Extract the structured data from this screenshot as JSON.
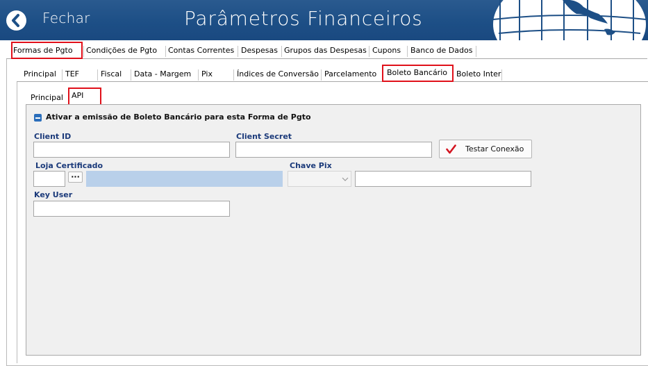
{
  "header": {
    "back_label": "Fechar",
    "title": "Parâmetros Financeiros",
    "icons": {
      "back": "chevron-left-icon",
      "logo": "globe-icon"
    }
  },
  "main_tabs": [
    "Formas de Pgto",
    "Condições de Pgto",
    "Contas Correntes",
    "Despesas",
    "Grupos das Despesas",
    "Cupons",
    "Banco de Dados"
  ],
  "main_tabs_selected": "Formas de Pgto",
  "sub_tabs": [
    "Principal",
    "TEF",
    "Fiscal",
    "Data - Margem",
    "Pix",
    "Índices de Conversão",
    "Parcelamento",
    "Boleto Bancário",
    "Boleto Inter"
  ],
  "sub_tabs_selected": "Boleto Bancário",
  "inner_tabs": [
    "Principal",
    "API"
  ],
  "inner_tabs_selected": "API",
  "form": {
    "activate_checkbox_label": "Ativar a emissão de Boleto Bancário para esta Forma de Pgto",
    "activate_checked": true,
    "client_id_label": "Client ID",
    "client_id_value": "",
    "client_secret_label": "Client Secret",
    "client_secret_value": "",
    "test_button_label": "Testar Conexão",
    "test_button_icon": "checkmark-icon",
    "loja_cert_label": "Loja Certificado",
    "loja_cert_value": "",
    "browse_button_label": "···",
    "chave_pix_label": "Chave Pix",
    "chave_pix_select_value": "",
    "chave_pix_value": "",
    "key_user_label": "Key User",
    "key_user_value": ""
  },
  "colors": {
    "header_bg": "#1d4f86",
    "highlight": "#e0101a",
    "label_blue": "#1b3a7a",
    "checkbox": "#2a6ebb"
  }
}
